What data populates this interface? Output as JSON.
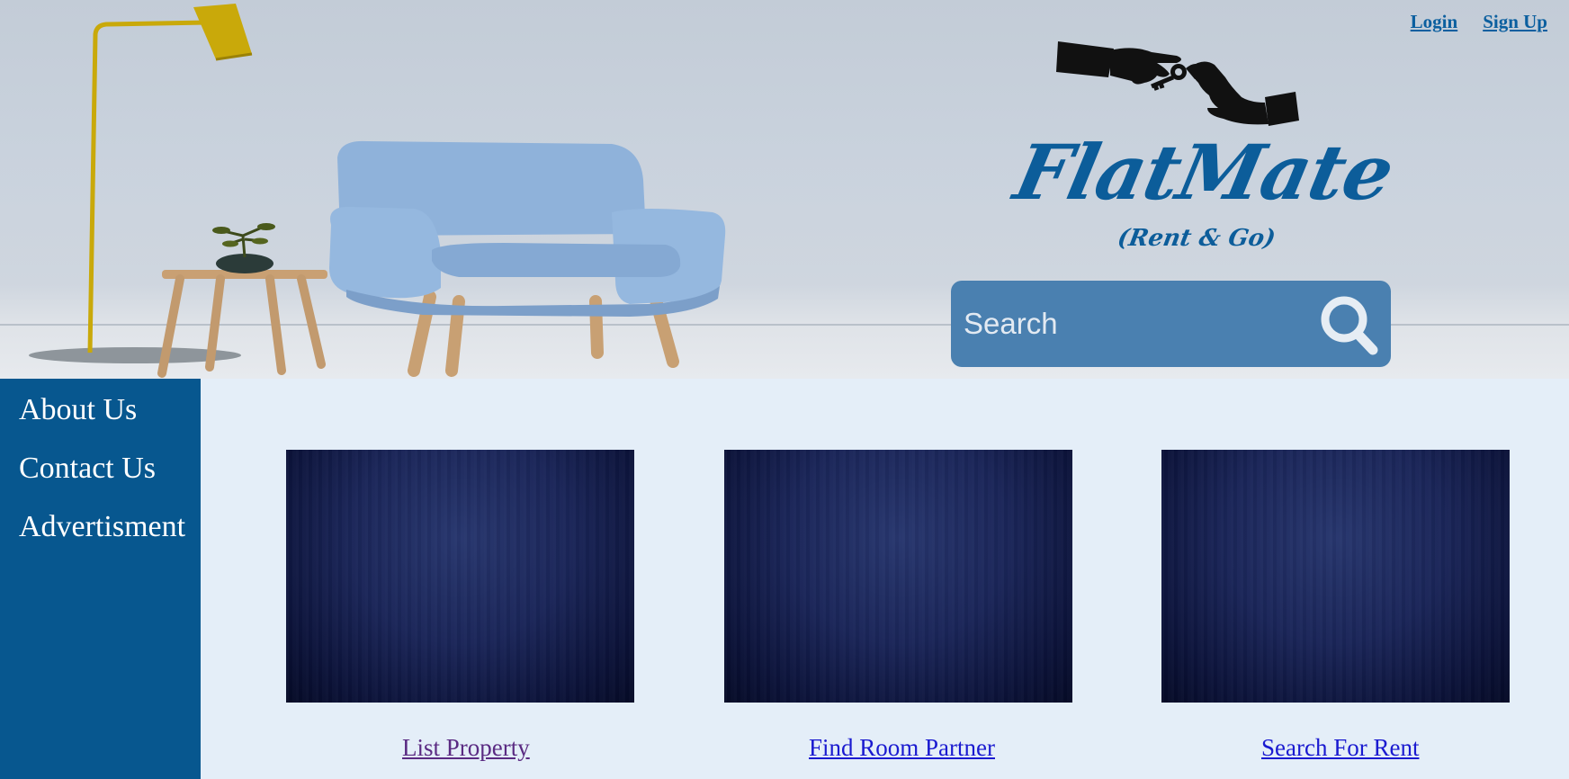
{
  "header": {
    "links": [
      {
        "label": "Login"
      },
      {
        "label": "Sign Up"
      }
    ],
    "logo": {
      "name": "FlatMate",
      "tagline": "(Rent & Go)"
    },
    "search": {
      "placeholder": "Search",
      "value": ""
    }
  },
  "sidebar": {
    "items": [
      {
        "label": "About Us"
      },
      {
        "label": "Contact Us"
      },
      {
        "label": "Advertisment"
      }
    ]
  },
  "main": {
    "cards": [
      {
        "label": "List Property",
        "link_color": "#5a2a82"
      },
      {
        "label": "Find Room Partner",
        "link_color": "#1a1ad0"
      },
      {
        "label": "Search For Rent",
        "link_color": "#1a1ad0"
      }
    ]
  },
  "colors": {
    "brand_blue": "#0c5d9a",
    "sidebar_bg": "#07578f",
    "search_bg": "#4a80b0",
    "page_bg": "#e4eef8"
  }
}
